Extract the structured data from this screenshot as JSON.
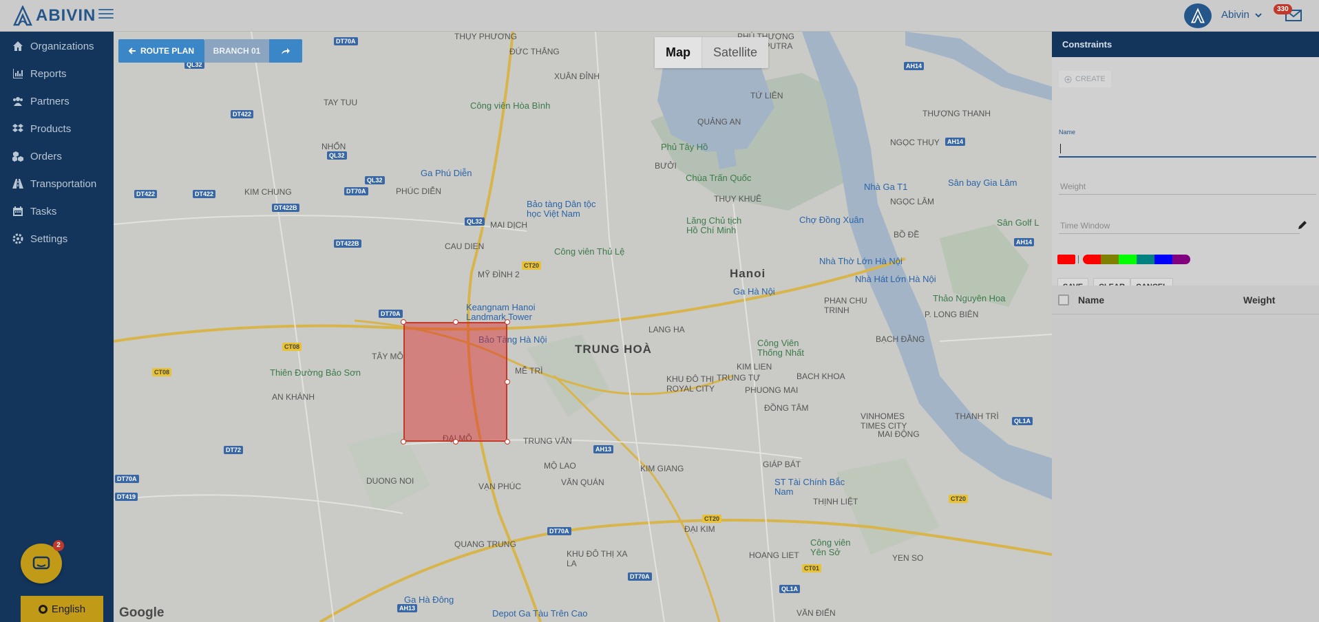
{
  "app": {
    "logo_text": "ABIVIN"
  },
  "header": {
    "user_name": "Abivin",
    "notification_count": "330"
  },
  "sidebar": {
    "items": [
      {
        "label": "Organizations",
        "icon": "home-icon"
      },
      {
        "label": "Reports",
        "icon": "bar-chart-icon"
      },
      {
        "label": "Partners",
        "icon": "users-icon"
      },
      {
        "label": "Products",
        "icon": "dropbox-icon"
      },
      {
        "label": "Orders",
        "icon": "cubes-icon"
      },
      {
        "label": "Transportation",
        "icon": "road-icon"
      },
      {
        "label": "Tasks",
        "icon": "calendar-icon"
      },
      {
        "label": "Settings",
        "icon": "gear-icon"
      }
    ],
    "chat_badge": "2",
    "language": "English"
  },
  "toolbar": {
    "route_plan": "ROUTE PLAN",
    "branch": "BRANCH 01"
  },
  "map": {
    "type_map": "Map",
    "type_satellite": "Satellite",
    "attribution": "Google",
    "labels": {
      "thuy_phuong": "THỤY PHƯƠNG",
      "duc_thang": "ĐỨC THẮNG",
      "phu_thuong": "PHÚ THƯỢNG",
      "phu_ciptra": "PHU CIPUTRA",
      "xuan_dinh": "XUÂN ĐỈNH",
      "tay_tuu": "TAY TUU",
      "tu_lien": "TỨ LIÊN",
      "thuong_thanh": "THƯỢNG THANH",
      "cv_hoa_binh": "Công viên Hòa Bình",
      "quang_an": "QUẢNG AN",
      "ngoc_thuy": "NGỌC THỤY",
      "nhon": "NHỔN",
      "phu_tay_ho": "Phủ Tây Hồ",
      "buoi": "BƯỞI",
      "kim_chung": "KIM CHUNG",
      "phuc_dien": "PHÚC DIỄN",
      "ga_phu_dien": "Ga Phú Diễn",
      "chua_tran_quoc": "Chùa Trấn Quốc",
      "thuy_khue": "THỤY KHUÊ",
      "nha_ga_t1": "Nhà Ga T1",
      "san_bay": "Sân bay Gia Lâm",
      "ngoc_lam": "NGỌC LÂM",
      "bao_tang_dtvn": "Bảo tàng Dân tộc học Việt Nam",
      "mai_dich": "MAI DỊCH",
      "lang_ho_chi_minh": "Lăng Chủ tịch Hồ Chí Minh",
      "cho_dong_xuan": "Chợ Đồng Xuân",
      "bo_de": "BỒ ĐỀ",
      "san_golf": "Sân Golf L",
      "cau_dien": "CAU DIEN",
      "cv_thu_le": "Công viên Thủ Lệ",
      "nha_tho": "Nhà Thờ Lớn Hà Nội",
      "my_dinh": "MỸ ĐÌNH 2",
      "hanoi": "Hanoi",
      "nha_hat": "Nhà Hát Lớn Hà Nội",
      "ga_ha_noi": "Ga Hà Nội",
      "thao_nguyen": "Thảo Nguyên Hoa",
      "keangnam": "Keangnam Hanoi Landmark Tower",
      "phan_chu_trinh": "PHAN CHU TRINH",
      "p_long_bien": "P. LONG BIÊN",
      "bao_tang_hn": "Bảo Tàng Hà Nội",
      "trung_hoa": "TRUNG HOÀ",
      "lang_ha": "LANG HA",
      "tay_mo": "TÂY MỖ",
      "cv_thong_nhat": "Công Viên Thống Nhất",
      "bach_dang": "BẠCH ĐẰNG",
      "thien_duong": "Thiên Đường Bảo Sơn",
      "me_tri": "MỄ TRÌ",
      "khu_do_thi_royal": "KHU ĐÔ THỊ ROYAL CITY",
      "kim_lien": "KIM LIEN",
      "trung_tu": "TRUNG TỰ",
      "bach_khoa": "BACH KHOA",
      "an_khanh": "AN KHÁNH",
      "phuong_mai": "PHUONG MAI",
      "dong_tam": "ĐỒNG TÂM",
      "vinhomes": "VINHOMES TIMES CITY",
      "thanh_tri": "THANH TRÌ",
      "dai_mo": "ĐẠI MỖ",
      "trung_van": "TRUNG VĂN",
      "mai_dong": "MAI ĐỘNG",
      "mo_lao": "MỘ LAO",
      "kim_giang": "KIM GIANG",
      "giap_bat": "GIÁP BÁT",
      "duong_noi": "DUONG NOI",
      "van_phuc": "VẠN PHÚC",
      "van_quan": "VĂN QUÁN",
      "st_bac_nam": "ST Tài Chính Bắc Nam",
      "thinh_liet": "THỊNH LIỆT",
      "dai_kim": "ĐẠI KIM",
      "quang_trung": "QUANG TRUNG",
      "cv_yen_so": "Công viên Yên Sở",
      "khu_do_thi_xa_la": "KHU ĐÔ THỊ XA LA",
      "hoang_liet": "HOANG LIET",
      "yen_so": "YEN SO",
      "ga_ha_dong": "Ga Hà Đông",
      "depot": "Depot Ga Tàu Trên Cao",
      "van_dien": "VĂN ĐIỂN"
    },
    "shields": {
      "dt70a": "DT70A",
      "ql32": "QL32",
      "dt422": "DT422",
      "dt422b": "DT422B",
      "ct20": "CT20",
      "ct08": "CT08",
      "dt72": "DT72",
      "dt419": "DT419",
      "ah13": "AH13",
      "ah14": "AH14",
      "ql1a": "QL1A",
      "ct01": "CT01"
    }
  },
  "panel": {
    "title": "Constraints",
    "create": "CREATE",
    "name_label": "Name",
    "name_value": "",
    "weight_placeholder": "Weight",
    "time_window_placeholder": "Time Window",
    "selected_color": "#ff0000",
    "palette": [
      "#ff0000",
      "#808000",
      "#00ff00",
      "#008080",
      "#0000ff",
      "#800080"
    ],
    "save": "SAVE",
    "clear": "CLEAR",
    "cancel": "CANCEL",
    "col_name": "Name",
    "col_weight": "Weight"
  }
}
